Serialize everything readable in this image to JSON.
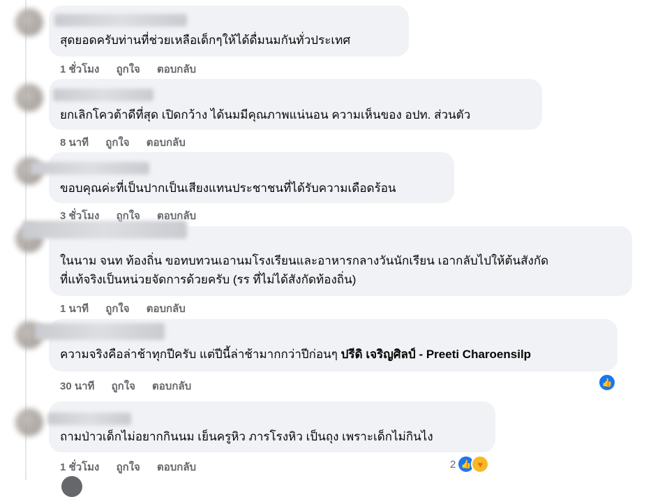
{
  "comments": [
    {
      "text": "สุดยอดครับท่านที่ช่วยเหลือเด็กๆให้ได้ดื่มนมกันทั่วประเทศ",
      "time": "1 ชั่วโมง",
      "like": "ถูกใจ",
      "reply": "ตอบกลับ"
    },
    {
      "text": "ยกเลิกโควต้าดีที่สุด เปิดกว้าง ได้นมมีคุณภาพแน่นอน ความเห็นของ อปท. ส่วนตัว",
      "time": "8 นาที",
      "like": "ถูกใจ",
      "reply": "ตอบกลับ"
    },
    {
      "text": "ขอบคุณค่ะที่เป็นปากเป็นเสียงแทนประชาชนที่ได้รับความเดือดร้อน",
      "time": "3 ชั่วโมง",
      "like": "ถูกใจ",
      "reply": "ตอบกลับ"
    },
    {
      "text_line1": "ในนาม จนท ท้องถิ่น ขอทบทวนเอานมโรงเรียนและอาหารกลางวันนักเรียน เอากลับไปให้ต้นสังกัด",
      "text_line2": "ที่แท้จริงเป็นหน่วยจัดการด้วยครับ (รร ที่ไม่ได้สังกัดท้องถิ่น)",
      "time": "1 นาที",
      "like": "ถูกใจ",
      "reply": "ตอบกลับ"
    },
    {
      "text": "ความจริงคือล่าช้าทุกปีครับ แต่ปีนี้ล่าช้ามากกว่าปีก่อนๆ ",
      "mention": "ปรีดิ เจริญศิลป์ - Preeti Charoensilp",
      "time": "30 นาที",
      "like": "ถูกใจ",
      "reply": "ตอบกลับ",
      "reaction_icon": "like-icon"
    },
    {
      "text": "ถามป่าวเด็กไม่อยากกินนม เย็นครูหิว ภารโรงหิว เป็นถุง เพราะเด็กไม่กินไง",
      "time": "1 ชั่วโมง",
      "like": "ถูกใจ",
      "reply": "ตอบกลับ",
      "reaction_count": "2",
      "reaction_icons": [
        "like-icon",
        "care-icon"
      ]
    }
  ],
  "colors": {
    "bubble": "#f0f2f5",
    "action_text": "#65676b",
    "like_blue": "#1877f2"
  }
}
